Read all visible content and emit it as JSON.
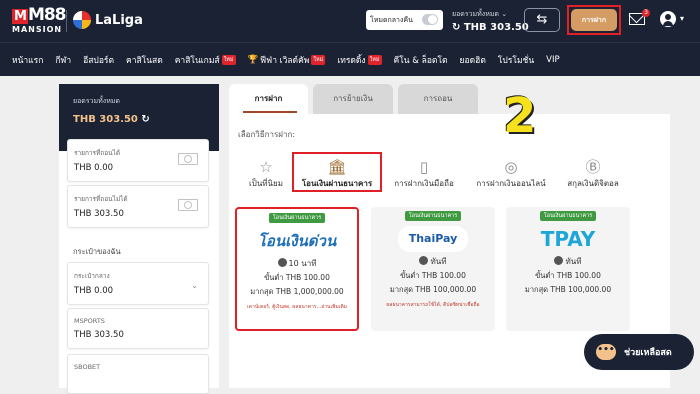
{
  "brand": {
    "logo_text": "M88",
    "logo_sub": "MANSION",
    "partner": "LaLiga"
  },
  "topbar": {
    "mode_label": "โหมดกลางคืน",
    "balance_label": "ยอดรวมทั้งหมด ⌄",
    "balance_value": "↻ THB 303.50",
    "deposit_label": "การฝาก",
    "mail_count": "3"
  },
  "nav": {
    "items": [
      {
        "label": "หน้าแรก",
        "hot": ""
      },
      {
        "label": "กีฬา",
        "hot": ""
      },
      {
        "label": "อีสปอร์ต",
        "hot": ""
      },
      {
        "label": "คาสิโนสด",
        "hot": ""
      },
      {
        "label": "คาสิโนเกมส์",
        "hot": "ใหม่"
      },
      {
        "label": "ฟีฟ่า เวิลด์คัพ",
        "hot": "ใหม่"
      },
      {
        "label": "เทรดดิ้ง",
        "hot": "ใหม่"
      },
      {
        "label": "คีโน & ล็อตโต",
        "hot": ""
      },
      {
        "label": "ยอดฮิต",
        "hot": ""
      },
      {
        "label": "โปรโมชั่น",
        "hot": ""
      },
      {
        "label": "VIP",
        "hot": ""
      }
    ]
  },
  "sidebar": {
    "total_label": "ยอดรวมทั้งหมด",
    "total_value": "THB 303.50",
    "withdrawable_label": "รายการที่ถอนได้",
    "withdrawable_value": "THB 0.00",
    "nonwithdrawable_label": "รายการที่ถอนไม่ได้",
    "nonwithdrawable_value": "THB 303.50",
    "wallet_title": "กระเป๋าของฉัน",
    "wallets": [
      {
        "name": "กระเป๋ากลาง",
        "value": "THB 0.00"
      },
      {
        "name": "MSPORTS",
        "value": "THB 303.50"
      },
      {
        "name": "SBOBET",
        "value": ""
      }
    ]
  },
  "tabs": [
    "การฝาก",
    "การย้ายเงิน",
    "การถอน"
  ],
  "choose_label": "เลือกวิธีการฝาก:",
  "methods": [
    {
      "label": "เป็นที่นิยม",
      "icon": "star-icon"
    },
    {
      "label": "โอนเงินผ่านธนาคาร",
      "icon": "bank-icon"
    },
    {
      "label": "การฝากเงินมือถือ",
      "icon": "mobile-icon"
    },
    {
      "label": "การฝากเงินออนไลน์",
      "icon": "globe-icon"
    },
    {
      "label": "สกุลเงินดิจิตอล",
      "icon": "bitcoin-icon"
    }
  ],
  "channels": [
    {
      "tag": "โอนเงินผ่านธนาคาร",
      "logo": "โอนเงินด่วน",
      "time": "10 นาที",
      "min": "ขั้นต่ำ THB 100.00",
      "max": "มากสุด THB 1,000,000.00",
      "note": "เคาน์เตอร์, ตู้เงินสด, ผลธนาคาร...อ่านเพิ่มเติม"
    },
    {
      "tag": "โอนเงินผ่านธนาคาร",
      "logo": "ThaiPay",
      "time": "ทันที",
      "min": "ขั้นต่ำ THB 100.00",
      "max": "มากสุด THB 100,000.00",
      "note": "ผลธนาคารสามารถใช้ได้, ดีปอซิทน่าเชื่อถือ"
    },
    {
      "tag": "โอนเงินผ่านธนาคาร",
      "logo": "TPAY",
      "time": "ทันที",
      "min": "ขั้นต่ำ THB 100.00",
      "max": "มากสุด THB 100,000.00",
      "note": ""
    }
  ],
  "annotation": "2",
  "help": {
    "label": "ช่วยเหลือสด"
  },
  "colors": {
    "navy": "#1b2234",
    "accent": "#d49b63",
    "highlight": "#e01f26",
    "tag_green": "#3f9a42"
  }
}
